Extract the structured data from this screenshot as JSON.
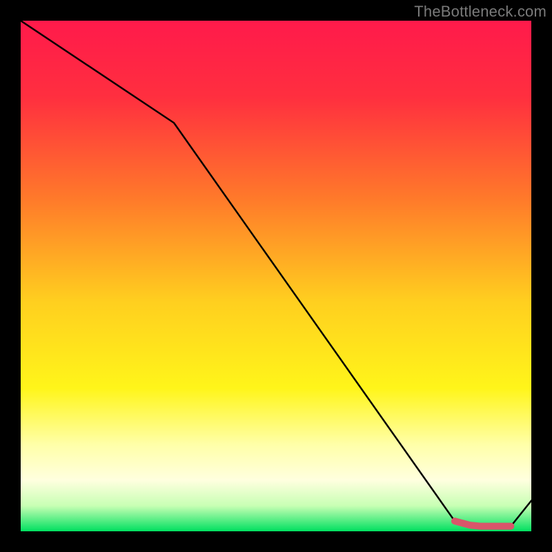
{
  "attribution": "TheBottleneck.com",
  "chart_data": {
    "type": "line",
    "title": "",
    "xlabel": "",
    "ylabel": "",
    "xlim": [
      0,
      100
    ],
    "ylim": [
      0,
      100
    ],
    "grid": false,
    "series": [
      {
        "name": "curve",
        "x": [
          0,
          30,
          85,
          88,
          93,
          96,
          100
        ],
        "y": [
          100,
          80,
          2,
          1,
          1,
          1,
          6
        ]
      }
    ],
    "marker_points": {
      "name": "highlight",
      "x": [
        85,
        88,
        90,
        93,
        96
      ],
      "y": [
        2,
        1.2,
        1,
        1,
        1
      ]
    },
    "gradient_stops": [
      {
        "offset": 0.0,
        "color": "#ff1a4b"
      },
      {
        "offset": 0.15,
        "color": "#ff2f3f"
      },
      {
        "offset": 0.35,
        "color": "#ff7a2a"
      },
      {
        "offset": 0.55,
        "color": "#ffcf1f"
      },
      {
        "offset": 0.72,
        "color": "#fff51a"
      },
      {
        "offset": 0.83,
        "color": "#ffffa8"
      },
      {
        "offset": 0.9,
        "color": "#ffffdf"
      },
      {
        "offset": 0.95,
        "color": "#c8ffb4"
      },
      {
        "offset": 1.0,
        "color": "#00e060"
      }
    ],
    "line_color": "#000000",
    "marker_color": "#d9566a"
  }
}
